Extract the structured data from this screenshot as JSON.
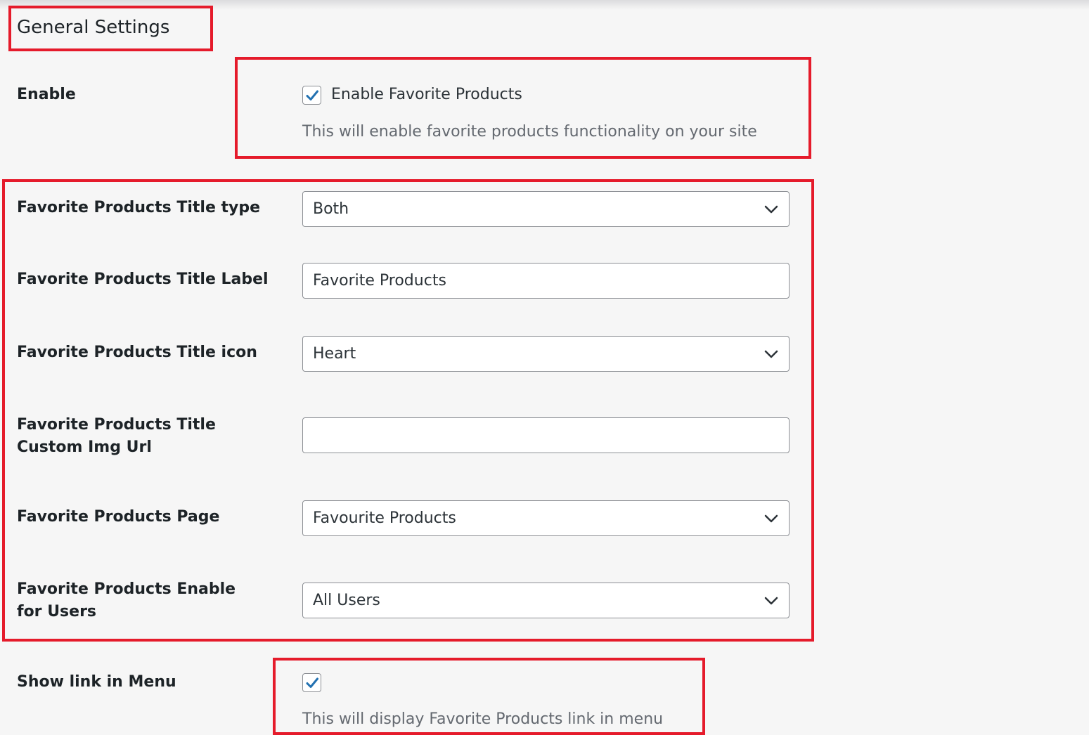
{
  "page": {
    "title": "General Settings"
  },
  "highlight_color": "#e51b2b",
  "enable": {
    "label": "Enable",
    "checkbox_label": "Enable Favorite Products",
    "checked": true,
    "description": "This will enable favorite products functionality on your site"
  },
  "title_type": {
    "label": "Favorite Products Title type",
    "value": "Both",
    "icon": "chevron-down-icon"
  },
  "title_label": {
    "label": "Favorite Products Title Label",
    "value": "Favorite Products"
  },
  "title_icon": {
    "label": "Favorite Products Title icon",
    "value": "Heart",
    "icon": "chevron-down-icon"
  },
  "custom_img": {
    "label": "Favorite Products Title Custom Img Url",
    "value": ""
  },
  "products_page": {
    "label": "Favorite Products Page",
    "value": "Favourite Products",
    "icon": "chevron-down-icon"
  },
  "enable_for_users": {
    "label": "Favorite Products Enable for Users",
    "value": "All Users",
    "icon": "chevron-down-icon"
  },
  "show_link": {
    "label": "Show link in Menu",
    "checked": true,
    "description": "This will display Favorite Products link in menu"
  }
}
